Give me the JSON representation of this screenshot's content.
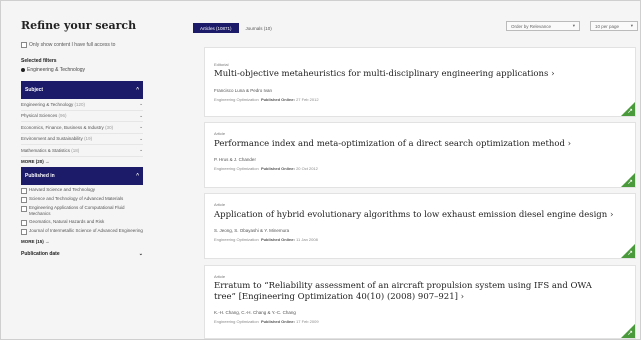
{
  "sidebar": {
    "title": "Refine your search",
    "only_label": "Only show content I have full access to",
    "selected_title": "Selected filters",
    "selected_filter": "Engineering & Technology",
    "subject_header": "Subject",
    "subjects": [
      {
        "label": "Engineering & Technology",
        "count": "(120)"
      },
      {
        "label": "Physical Sciences",
        "count": "(96)"
      },
      {
        "label": "Economics, Finance, Business & Industry",
        "count": "(30)"
      },
      {
        "label": "Environment and Sustainability",
        "count": "(19)"
      },
      {
        "label": "Mathematics & Statistics",
        "count": "(18)"
      }
    ],
    "more_label": "MORE (20) →",
    "published_header": "Published in",
    "publications": [
      "Harvard Science and Technology",
      "Science and Technology of Advanced Materials",
      "Engineering Applications of Computational Fluid Mechanics",
      "Geomatics, Natural Hazards and Risk",
      "Journal of Intermetallic Science of Advanced Engineering"
    ],
    "more_label_2": "MORE (15) →",
    "pubdate_header": "Publication date"
  },
  "topbar": {
    "tab_articles": "Articles (10871)",
    "tab_journals": "Journals (10)",
    "order_label": "Order by Relevance",
    "perpage_label": "10 per page"
  },
  "results": [
    {
      "type": "Editorial",
      "title": "Multi-objective metaheuristics for multi-disciplinary engineering applications",
      "authors": "Francisco Luna & Pedro Ivan",
      "journal": "Engineering Optimization",
      "published_label": "Published Online:",
      "date": "27 Feb 2012"
    },
    {
      "type": "Article",
      "title": "Performance index and meta-optimization of a direct search optimization method",
      "authors": "P. Hrus & J. Chander",
      "journal": "Engineering Optimization",
      "published_label": "Published Online:",
      "date": "20 Oct 2012"
    },
    {
      "type": "Article",
      "title": "Application of hybrid evolutionary algorithms to low exhaust emission diesel engine design",
      "authors": "S. Jeong, S. Obayashi & Y. Minemura",
      "journal": "Engineering Optimization",
      "published_label": "Published Online:",
      "date": "11 Jan 2008"
    },
    {
      "type": "Article",
      "title": "Erratum to “Reliability assessment of an aircraft propulsion system using IFS and OWA tree” [Engineering Optimization 40(10) (2008) 907–921]",
      "authors": "K.-H. Chang, C.-H. Chang & Y.-C. Chang",
      "journal": "Engineering Optimization",
      "published_label": "Published Online:",
      "date": "17 Feb 2009"
    }
  ],
  "colors": {
    "navy": "#1c1b6a",
    "access_green": "#4a9a3b"
  },
  "icons": {
    "chevron": "chevron-down-icon",
    "arrow": "chevron-right-icon",
    "access": "open-access-icon"
  }
}
